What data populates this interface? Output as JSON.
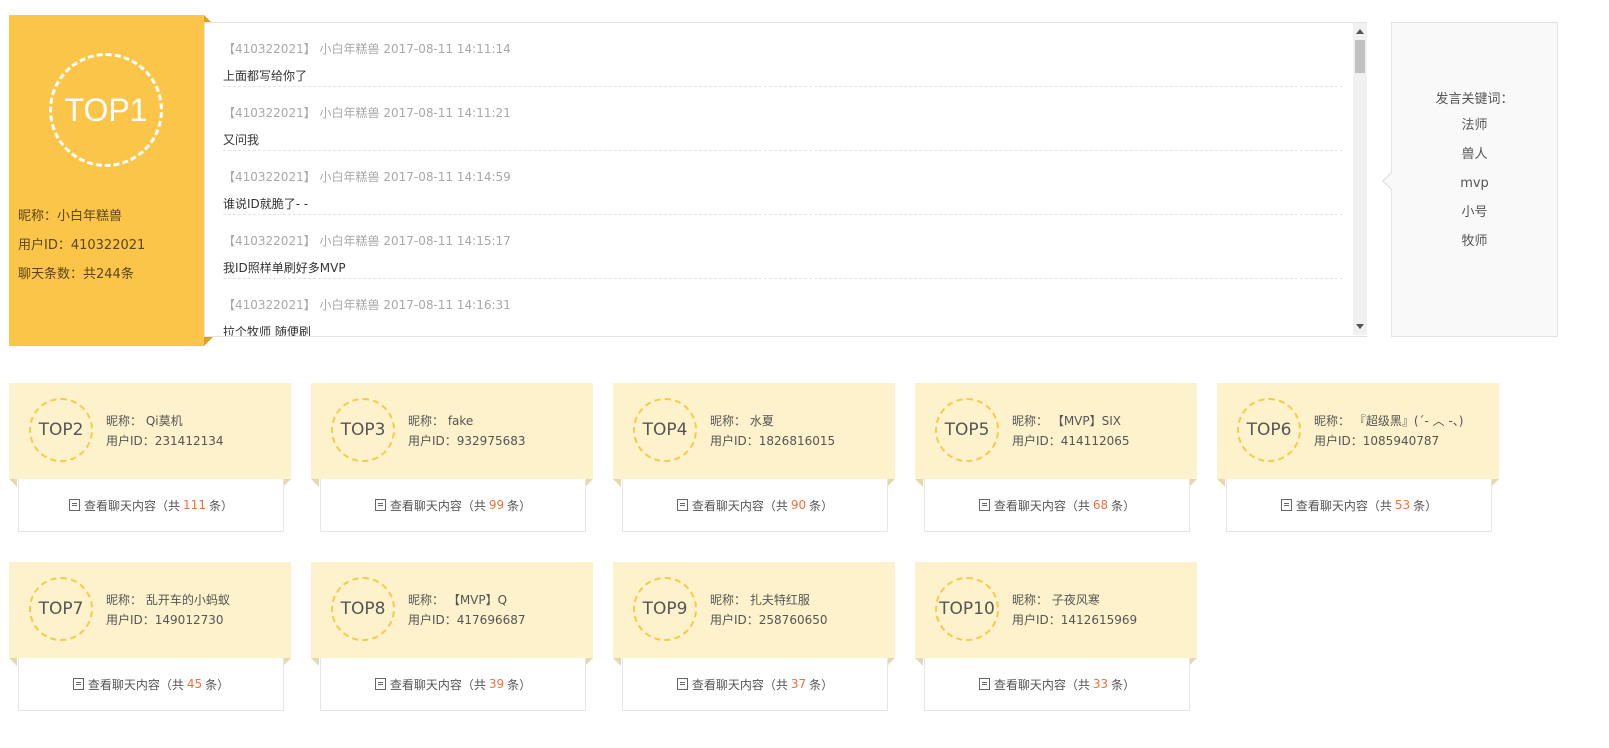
{
  "top1": {
    "rank": "TOP1",
    "nick": "昵称：小白年糕兽",
    "uid": "用户ID：410322021",
    "count": "聊天条数：共244条"
  },
  "chat": {
    "messages": [
      {
        "meta": "【410322021】 小白年糕兽 2017-08-11 14:11:14",
        "text": "上面都写给你了"
      },
      {
        "meta": "【410322021】 小白年糕兽 2017-08-11 14:11:21",
        "text": "又问我"
      },
      {
        "meta": "【410322021】 小白年糕兽 2017-08-11 14:14:59",
        "text": "谁说ID就脆了- -"
      },
      {
        "meta": "【410322021】 小白年糕兽 2017-08-11 14:15:17",
        "text": "我ID照样单刷好多MVP"
      },
      {
        "meta": "【410322021】 小白年糕兽 2017-08-11 14:16:31",
        "text": "拉个牧师 随便刷"
      }
    ]
  },
  "keywords": {
    "title": "发言关键词：",
    "items": [
      "法师",
      "兽人",
      "mvp",
      "小号",
      "牧师"
    ]
  },
  "cards": [
    {
      "rank": "TOP2",
      "nick": "昵称： Qi莫机",
      "uid": "用户ID：231412134",
      "view_prefix": "查看聊天内容（共",
      "count": "111",
      "view_suffix": "条）"
    },
    {
      "rank": "TOP3",
      "nick": "昵称： fake",
      "uid": "用户ID：932975683",
      "view_prefix": "查看聊天内容（共",
      "count": "99",
      "view_suffix": "条）"
    },
    {
      "rank": "TOP4",
      "nick": "昵称： 水夏",
      "uid": "用户ID：1826816015",
      "view_prefix": "查看聊天内容（共",
      "count": "90",
      "view_suffix": "条）"
    },
    {
      "rank": "TOP5",
      "nick": "昵称： 【MVP】SIX",
      "uid": "用户ID：414112065",
      "view_prefix": "查看聊天内容（共",
      "count": "68",
      "view_suffix": "条）"
    },
    {
      "rank": "TOP6",
      "nick": "昵称： 『超级黑』(´- ︿ -、)",
      "uid": "用户ID：1085940787",
      "view_prefix": "查看聊天内容（共",
      "count": "53",
      "view_suffix": "条）"
    },
    {
      "rank": "TOP7",
      "nick": "昵称： 乱开车的小蚂蚁",
      "uid": "用户ID：149012730",
      "view_prefix": "查看聊天内容（共",
      "count": "45",
      "view_suffix": "条）"
    },
    {
      "rank": "TOP8",
      "nick": "昵称： 【MVP】Q",
      "uid": "用户ID：417696687",
      "view_prefix": "查看聊天内容（共",
      "count": "39",
      "view_suffix": "条）"
    },
    {
      "rank": "TOP9",
      "nick": "昵称： 扎夫特红服",
      "uid": "用户ID：258760650",
      "view_prefix": "查看聊天内容（共",
      "count": "37",
      "view_suffix": "条）"
    },
    {
      "rank": "TOP10",
      "nick": "昵称： 子夜风寒",
      "uid": "用户ID：1412615969",
      "view_prefix": "查看聊天内容（共",
      "count": "33",
      "view_suffix": "条）"
    }
  ],
  "colors": {
    "top1_bg": "#fbc54a",
    "card_bg": "#fdf2cb",
    "count_accent": "#f0703a",
    "ring_dash": "#f2cc4a"
  },
  "icons": {
    "view": "document-list-icon"
  }
}
